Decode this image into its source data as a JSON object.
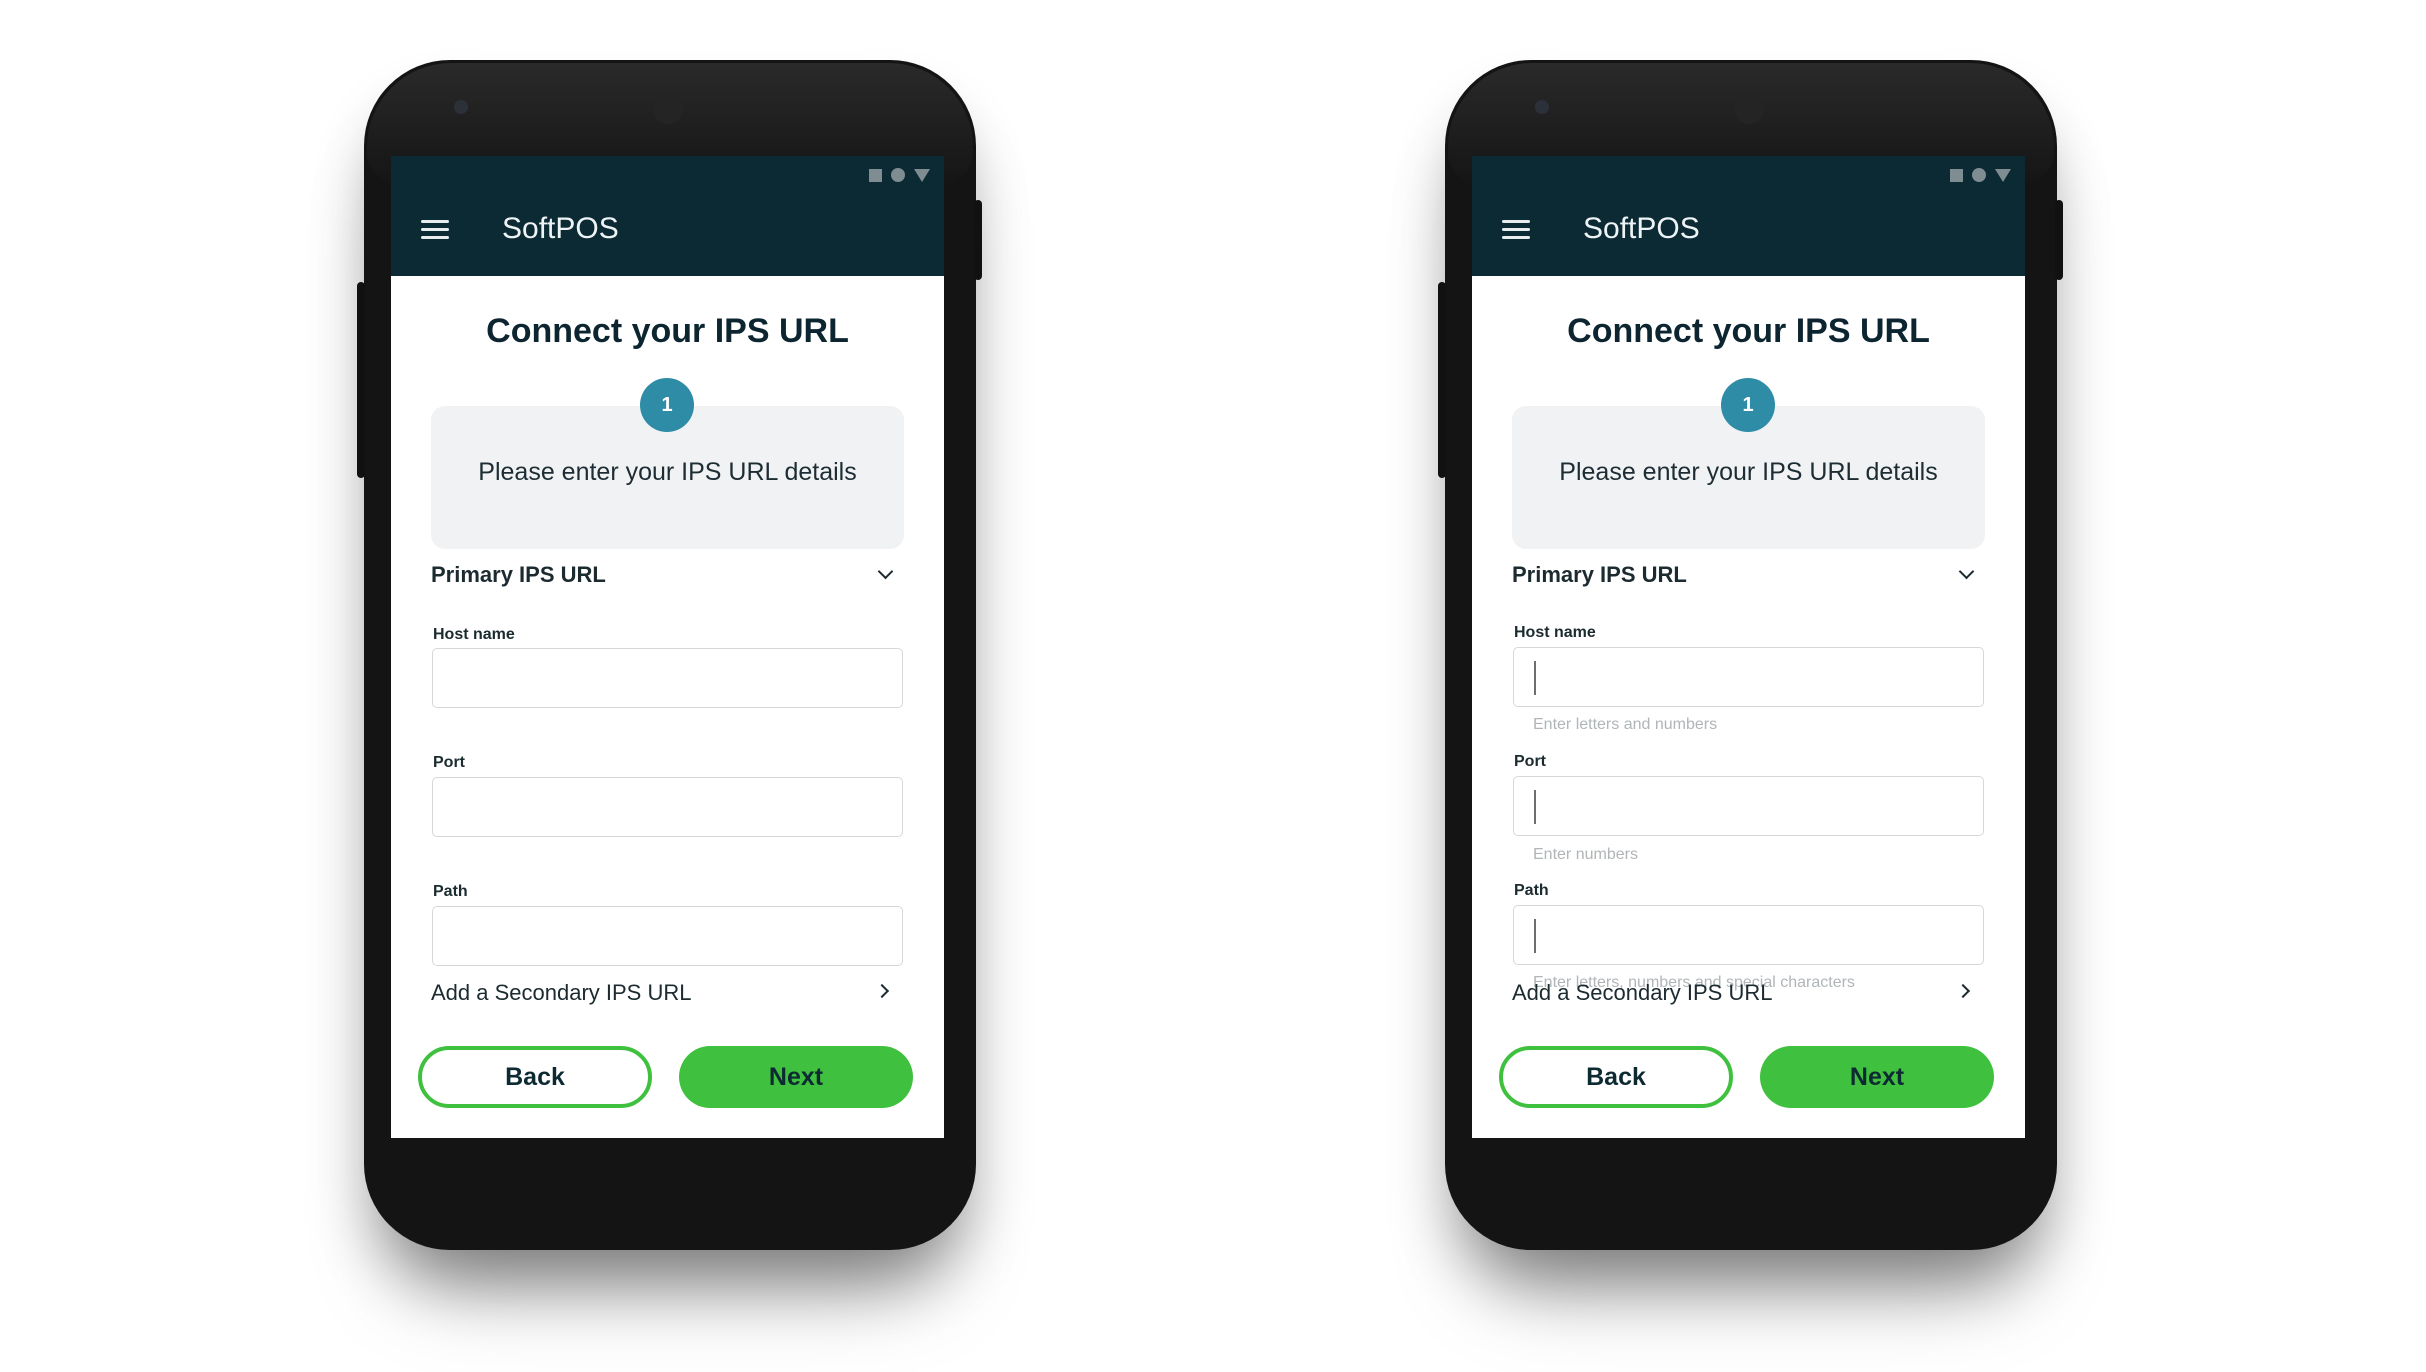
{
  "screens": [
    {
      "app_title": "SoftPOS",
      "page_title": "Connect your IPS URL",
      "step_number": "1",
      "step_text": "Please enter your IPS URL details",
      "section_title": "Primary IPS URL",
      "fields": [
        {
          "label": "Host name",
          "hint": ""
        },
        {
          "label": "Port",
          "hint": ""
        },
        {
          "label": "Path",
          "hint": ""
        }
      ],
      "secondary_label": "Add a Secondary IPS URL",
      "back_label": "Back",
      "next_label": "Next"
    },
    {
      "app_title": "SoftPOS",
      "page_title": "Connect your IPS URL",
      "step_number": "1",
      "step_text": "Please enter your IPS URL details",
      "section_title": "Primary IPS URL",
      "fields": [
        {
          "label": "Host name",
          "hint": "Enter letters and numbers"
        },
        {
          "label": "Port",
          "hint": "Enter numbers"
        },
        {
          "label": "Path",
          "hint": "Enter letters, numbers and special characters"
        }
      ],
      "secondary_label": "Add a Secondary IPS URL",
      "back_label": "Back",
      "next_label": "Next"
    }
  ],
  "colors": {
    "appbar": "#0b2a33",
    "accent_green": "#3fc13f",
    "step_badge": "#2f8ca6"
  },
  "icons": [
    "hamburger-menu-icon",
    "chevron-down-icon",
    "chevron-right-icon",
    "status-square-icon",
    "status-circle-icon",
    "status-triangle-icon"
  ]
}
